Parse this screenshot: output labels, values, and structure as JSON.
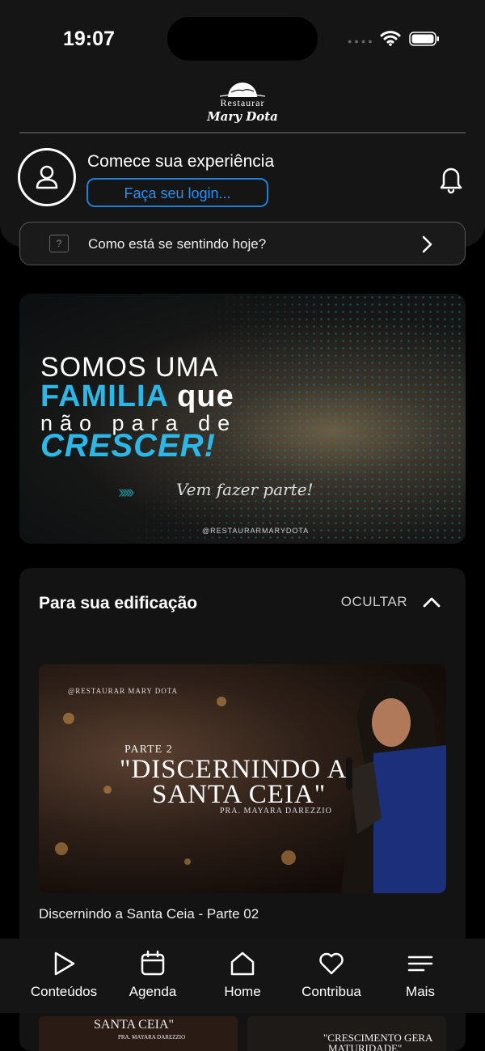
{
  "status": {
    "time": "19:07"
  },
  "logo": {
    "line1": "Restaurar",
    "line2": "Mary Dota"
  },
  "profile": {
    "welcome": "Comece sua experiência",
    "login_label": "Faça seu login..."
  },
  "feeling": {
    "prompt": "Como está se sentindo hoje?"
  },
  "banner": {
    "line1": "SOMOS UMA",
    "line2_a": "FAMILIA",
    "line2_b": "que",
    "line3": "não para de",
    "line4": "CRESCER!",
    "arrows": "›››››",
    "script": "Vem fazer parte!",
    "handle": "@RESTAURARMARYDOTA"
  },
  "edification": {
    "title": "Para sua edificação",
    "hide_label": "OCULTAR",
    "video": {
      "brand": "@RESTAURAR MARY DOTA",
      "part": "PARTE 2",
      "title1": "\"DISCERNINDO A",
      "title2": "SANTA CEIA\"",
      "pastor": "PRA. MAYARA DAREZZIO",
      "caption": "Discernindo a Santa Ceia - Parte 02"
    }
  },
  "thumbs": {
    "a_title": "SANTA CEIA\"",
    "a_pastor": "PRA. MAYARA DAREZZIO",
    "b_title1": "\"CRESCIMENTO GERA",
    "b_title2": "MATURIDADE\""
  },
  "tabs": [
    {
      "label": "Conteúdos",
      "icon": "play-icon"
    },
    {
      "label": "Agenda",
      "icon": "calendar-icon"
    },
    {
      "label": "Home",
      "icon": "home-icon"
    },
    {
      "label": "Contribua",
      "icon": "heart-icon"
    },
    {
      "label": "Mais",
      "icon": "menu-icon"
    }
  ],
  "colors": {
    "accent": "#2a8ff0",
    "banner_cyan": "#2bb8e8",
    "background": "#000000",
    "surface": "#151515"
  }
}
